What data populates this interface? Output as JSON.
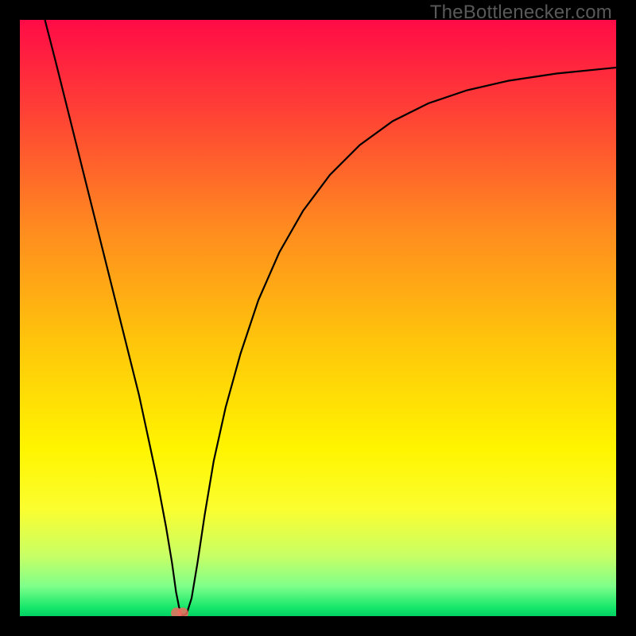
{
  "watermark": "TheBottlenecker.com",
  "chart_data": {
    "type": "line",
    "title": "",
    "xlabel": "",
    "ylabel": "",
    "xlim": [
      0,
      1
    ],
    "ylim": [
      0,
      1
    ],
    "background_gradient": {
      "stops": [
        {
          "offset": 0.0,
          "color": "#ff0b46"
        },
        {
          "offset": 0.15,
          "color": "#ff3f36"
        },
        {
          "offset": 0.35,
          "color": "#ff8b1f"
        },
        {
          "offset": 0.55,
          "color": "#ffc80a"
        },
        {
          "offset": 0.72,
          "color": "#fff500"
        },
        {
          "offset": 0.82,
          "color": "#fbfe2f"
        },
        {
          "offset": 0.9,
          "color": "#c7ff66"
        },
        {
          "offset": 0.95,
          "color": "#7eff8a"
        },
        {
          "offset": 0.985,
          "color": "#17e76b"
        },
        {
          "offset": 1.0,
          "color": "#00d264"
        }
      ]
    },
    "series": [
      {
        "name": "bottleneck-curve",
        "color": "#000000",
        "points": [
          {
            "x": 0.042,
            "y": 1.0
          },
          {
            "x": 0.06,
            "y": 0.93
          },
          {
            "x": 0.08,
            "y": 0.85
          },
          {
            "x": 0.1,
            "y": 0.77
          },
          {
            "x": 0.12,
            "y": 0.69
          },
          {
            "x": 0.14,
            "y": 0.61
          },
          {
            "x": 0.16,
            "y": 0.53
          },
          {
            "x": 0.18,
            "y": 0.45
          },
          {
            "x": 0.2,
            "y": 0.37
          },
          {
            "x": 0.215,
            "y": 0.3
          },
          {
            "x": 0.23,
            "y": 0.23
          },
          {
            "x": 0.245,
            "y": 0.15
          },
          {
            "x": 0.255,
            "y": 0.09
          },
          {
            "x": 0.262,
            "y": 0.04
          },
          {
            "x": 0.268,
            "y": 0.01
          },
          {
            "x": 0.273,
            "y": 0.0
          },
          {
            "x": 0.28,
            "y": 0.005
          },
          {
            "x": 0.288,
            "y": 0.03
          },
          {
            "x": 0.298,
            "y": 0.09
          },
          {
            "x": 0.31,
            "y": 0.17
          },
          {
            "x": 0.325,
            "y": 0.26
          },
          {
            "x": 0.345,
            "y": 0.35
          },
          {
            "x": 0.37,
            "y": 0.44
          },
          {
            "x": 0.4,
            "y": 0.53
          },
          {
            "x": 0.435,
            "y": 0.61
          },
          {
            "x": 0.475,
            "y": 0.68
          },
          {
            "x": 0.52,
            "y": 0.74
          },
          {
            "x": 0.57,
            "y": 0.79
          },
          {
            "x": 0.625,
            "y": 0.83
          },
          {
            "x": 0.685,
            "y": 0.86
          },
          {
            "x": 0.75,
            "y": 0.882
          },
          {
            "x": 0.82,
            "y": 0.898
          },
          {
            "x": 0.9,
            "y": 0.91
          },
          {
            "x": 1.0,
            "y": 0.92
          }
        ]
      }
    ],
    "marker": {
      "x": 0.268,
      "y": 0.005,
      "color": "#ef6b5e"
    }
  }
}
